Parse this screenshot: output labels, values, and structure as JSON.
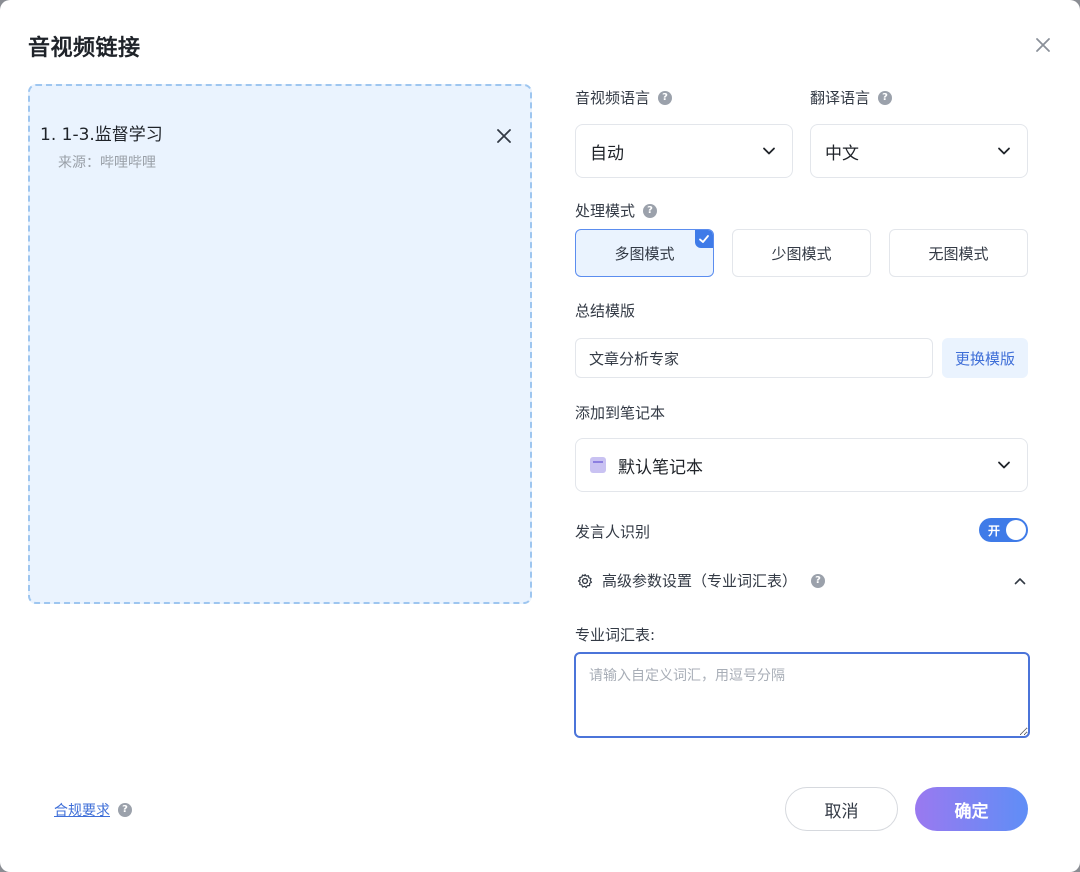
{
  "dialog": {
    "title": "音视频链接"
  },
  "item": {
    "title": "1. 1-3.监督学习",
    "source": "来源：哔哩哔哩"
  },
  "form": {
    "av_language_label": "音视频语言",
    "av_language_value": "自动",
    "translate_label": "翻译语言",
    "translate_value": "中文",
    "mode_label": "处理模式",
    "modes": [
      "多图模式",
      "少图模式",
      "无图模式"
    ],
    "selected_mode": "多图模式",
    "template_label": "总结模版",
    "template_value": "文章分析专家",
    "change_template_label": "更换模版",
    "notebook_label": "添加到笔记本",
    "notebook_value": "默认笔记本",
    "speaker_label": "发言人识别",
    "speaker_toggle_text": "开",
    "speaker_enabled": true,
    "advanced_label": "高级参数设置（专业词汇表）",
    "vocab_label": "专业词汇表:",
    "vocab_placeholder": "请输入自定义词汇，用逗号分隔",
    "vocab_value": ""
  },
  "footer": {
    "compliance_label": "合规要求",
    "cancel_label": "取消",
    "confirm_label": "确定"
  },
  "colors": {
    "accent": "#3f7be8",
    "dropzone_bg": "#eaf3fe",
    "confirm_gradient_start": "#9a79f0",
    "confirm_gradient_end": "#5f8ef6"
  },
  "icons": {
    "close": "close-icon",
    "remove_item": "remove-item-icon",
    "help": "help-icon",
    "chevron_down": "chevron-down-icon",
    "check": "check-icon",
    "notebook": "notebook-icon",
    "gear": "gear-icon",
    "chevron_up": "chevron-up-icon"
  }
}
